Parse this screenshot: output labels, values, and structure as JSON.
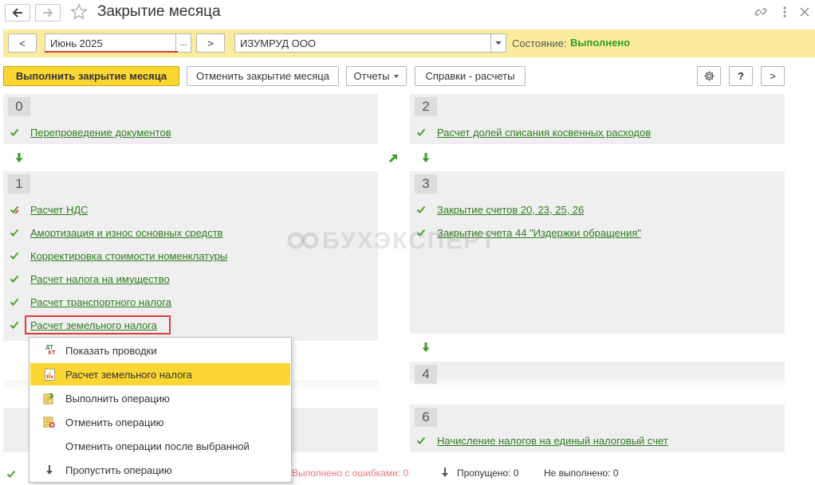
{
  "title": "Закрытие месяца",
  "topbar": {
    "prev_label": "<",
    "next_label": ">",
    "period": "Июнь 2025",
    "dots": "...",
    "organization": "ИЗУМРУД ООО",
    "state_label": "Состояние:",
    "state_value": "Выполнено"
  },
  "commands": {
    "execute": "Выполнить закрытие месяца",
    "cancel": "Отменить закрытие месяца",
    "reports": "Отчеты",
    "references": "Справки - расчеты",
    "help": "?",
    "more": ">"
  },
  "stages": {
    "s0": {
      "num": "0",
      "ops": [
        "Перепроведение документов"
      ]
    },
    "s1": {
      "num": "1",
      "ops": [
        "Расчет НДС",
        "Амортизация и износ основных средств",
        "Корректировка стоимости номенклатуры",
        "Расчет налога на имущество",
        "Расчет транспортного налога",
        "Расчет земельного налога"
      ]
    },
    "s2": {
      "num": "2",
      "ops": [
        "Расчет долей списания косвенных расходов"
      ]
    },
    "s3": {
      "num": "3",
      "ops": [
        "Закрытие счетов 20, 23, 25, 26",
        "Закрытие счета 44 \"Издержки обращения\""
      ]
    },
    "s4": {
      "num": "4"
    },
    "s6": {
      "num": "6",
      "ops": [
        "Начисление налогов на единый налоговый счет"
      ]
    }
  },
  "context_menu": {
    "items": [
      "Показать проводки",
      "Расчет земельного налога",
      "Выполнить операцию",
      "Отменить операцию",
      "Отменить операции после выбранной",
      "Пропустить операцию"
    ],
    "active_index": 1,
    "dtkt_top": "ДТ",
    "dtkt_bottom": "КТ"
  },
  "watermark": "БУХЭКСПЕРТ",
  "status": {
    "errors": "Выполнено с ошибками: 0",
    "skipped": "Пропущено: 0",
    "not_done": "Не выполнено: 0"
  },
  "colors": {
    "accent_yellow": "#fcd733",
    "topbar_bg": "#fbec9d",
    "link_green": "#2d7d1f",
    "ok_green": "#2e9e24",
    "error_red": "#e23a3a",
    "panel_bg": "#efefef"
  }
}
